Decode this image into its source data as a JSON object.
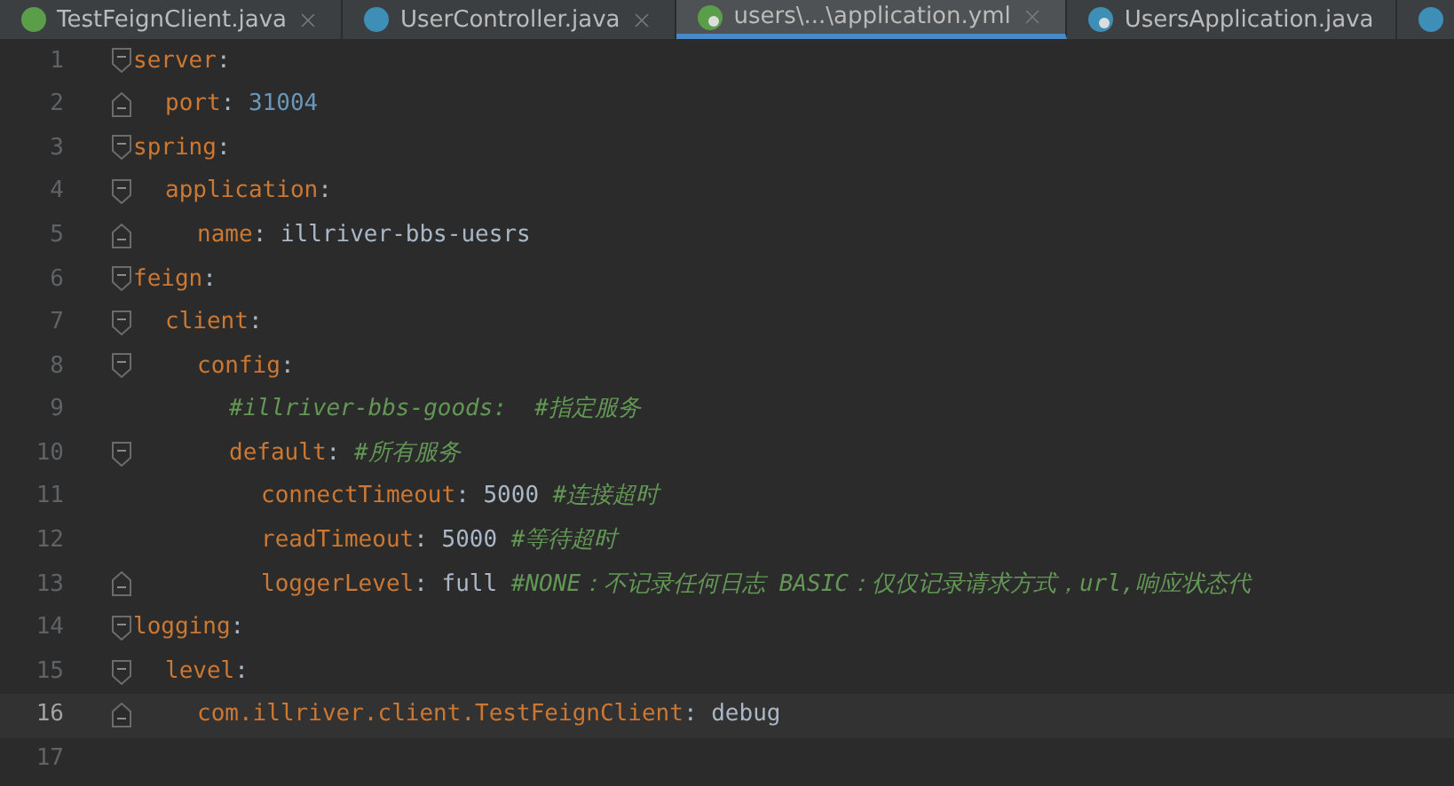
{
  "tabs": [
    {
      "label": "TestFeignClient.java",
      "kind": "interface",
      "selected": false,
      "close_button": true
    },
    {
      "label": "UserController.java",
      "kind": "class",
      "selected": false,
      "close_button": true
    },
    {
      "label": "users\\...\\application.yml",
      "kind": "yaml",
      "selected": true,
      "close_button": true
    },
    {
      "label": "UsersApplication.java",
      "kind": "app",
      "selected": false,
      "close_button": false
    },
    {
      "kind": "class",
      "selected": false,
      "close_button": false
    }
  ],
  "editor": {
    "lines": [
      {
        "number": "1",
        "kind": "start",
        "current": false,
        "tokens": [
          {
            "kind": "key",
            "text": "server"
          },
          {
            "kind": "punct",
            "text": ":"
          }
        ],
        "children": [
          {
            "number": "2",
            "kind": "end",
            "current": false,
            "tokens": [
              {
                "kind": "key",
                "text": "port"
              },
              {
                "kind": "punct",
                "text": ": "
              },
              {
                "kind": "number",
                "text": "31004"
              }
            ]
          }
        ]
      },
      {
        "number": "3",
        "kind": "start",
        "current": false,
        "tokens": [
          {
            "kind": "key",
            "text": "spring"
          },
          {
            "kind": "punct",
            "text": ":"
          }
        ],
        "children": [
          {
            "number": "4",
            "kind": "start",
            "current": false,
            "tokens": [
              {
                "kind": "key",
                "text": "application"
              },
              {
                "kind": "punct",
                "text": ":"
              }
            ],
            "children": [
              {
                "number": "5",
                "kind": "end",
                "current": false,
                "tokens": [
                  {
                    "kind": "key",
                    "text": "name"
                  },
                  {
                    "kind": "punct",
                    "text": ": "
                  },
                  {
                    "kind": "value",
                    "text": "illriver-bbs-uesrs"
                  }
                ]
              }
            ]
          }
        ]
      },
      {
        "number": "6",
        "kind": "start",
        "current": false,
        "tokens": [
          {
            "kind": "key",
            "text": "feign"
          },
          {
            "kind": "punct",
            "text": ":"
          }
        ],
        "children": [
          {
            "number": "7",
            "kind": "start",
            "current": false,
            "tokens": [
              {
                "kind": "key",
                "text": "client"
              },
              {
                "kind": "punct",
                "text": ":"
              }
            ],
            "children": [
              {
                "number": "8",
                "kind": "start",
                "current": false,
                "tokens": [
                  {
                    "kind": "key",
                    "text": "config"
                  },
                  {
                    "kind": "punct",
                    "text": ":"
                  }
                ],
                "children": [
                  {
                    "number": "9",
                    "kind": "plain",
                    "current": false,
                    "tokens": [
                      {
                        "kind": "comment",
                        "text": "#illriver-bbs-goods:  #指定服务"
                      }
                    ]
                  },
                  {
                    "number": "10",
                    "kind": "start",
                    "current": false,
                    "tokens": [
                      {
                        "kind": "key",
                        "text": "default"
                      },
                      {
                        "kind": "punct",
                        "text": ": "
                      },
                      {
                        "kind": "comment",
                        "text": "#所有服务"
                      }
                    ],
                    "children": [
                      {
                        "number": "11",
                        "kind": "plain",
                        "current": false,
                        "tokens": [
                          {
                            "kind": "key",
                            "text": "connectTimeout"
                          },
                          {
                            "kind": "punct",
                            "text": ": "
                          },
                          {
                            "kind": "value",
                            "text": "5000"
                          },
                          {
                            "kind": "comment",
                            "text": " #连接超时"
                          }
                        ]
                      },
                      {
                        "number": "12",
                        "kind": "plain",
                        "current": false,
                        "tokens": [
                          {
                            "kind": "key",
                            "text": "readTimeout"
                          },
                          {
                            "kind": "punct",
                            "text": ": "
                          },
                          {
                            "kind": "value",
                            "text": "5000"
                          },
                          {
                            "kind": "comment",
                            "text": " #等待超时"
                          }
                        ]
                      },
                      {
                        "number": "13",
                        "kind": "end",
                        "current": false,
                        "tokens": [
                          {
                            "kind": "key",
                            "text": "loggerLevel"
                          },
                          {
                            "kind": "punct",
                            "text": ": "
                          },
                          {
                            "kind": "value",
                            "text": "full"
                          },
                          {
                            "kind": "comment",
                            "text": " #NONE：不记录任何日志 BASIC：仅仅记录请求方式，url,响应状态代"
                          }
                        ]
                      }
                    ]
                  }
                ]
              }
            ]
          }
        ]
      },
      {
        "number": "14",
        "kind": "start",
        "current": false,
        "tokens": [
          {
            "kind": "key",
            "text": "logging"
          },
          {
            "kind": "punct",
            "text": ":"
          }
        ],
        "children": [
          {
            "number": "15",
            "kind": "start",
            "current": false,
            "tokens": [
              {
                "kind": "key",
                "text": "level"
              },
              {
                "kind": "punct",
                "text": ":"
              }
            ],
            "children": [
              {
                "number": "16",
                "kind": "end",
                "current": true,
                "tokens": [
                  {
                    "kind": "key",
                    "text": "com.illriver.client.TestFeignClient"
                  },
                  {
                    "kind": "punct",
                    "text": ": "
                  },
                  {
                    "kind": "value",
                    "text": "debug"
                  }
                ]
              }
            ]
          }
        ]
      },
      {
        "number": "17",
        "kind": "plain",
        "current": false
      }
    ]
  }
}
